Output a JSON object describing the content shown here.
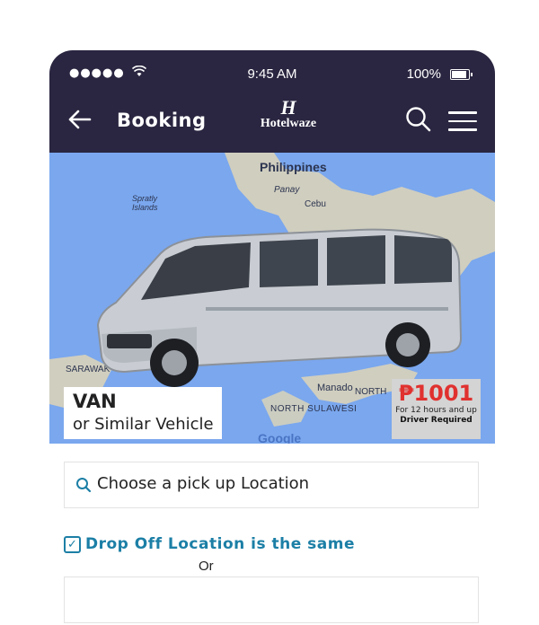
{
  "status_bar": {
    "signal": "●●●●●",
    "time": "9:45 AM",
    "battery": "100%"
  },
  "header": {
    "title": "Booking",
    "logo_text": "Hotelwaze",
    "logo_mark": "H"
  },
  "map": {
    "labels": [
      "Philippines",
      "Panay",
      "Cebu",
      "Spratly Islands",
      "SARAWAK",
      "Manado",
      "NORTH",
      "NORTH SULAWESI",
      "Google"
    ]
  },
  "vehicle": {
    "type": "VAN",
    "subtitle": "or Similar Vehicle"
  },
  "price": {
    "amount": "₱1001",
    "note": "For 12 hours and up",
    "requirement": "Driver Required"
  },
  "form": {
    "pickup_placeholder": "Choose a pick up Location",
    "same_dropoff_label": "Drop Off Location is the same",
    "same_dropoff_checked": true,
    "or_text": "Or"
  },
  "colors": {
    "header_bg": "#2a2540",
    "accent": "#1c7fa6",
    "price_red": "#e0312f",
    "map_water": "#7aa7ee"
  }
}
